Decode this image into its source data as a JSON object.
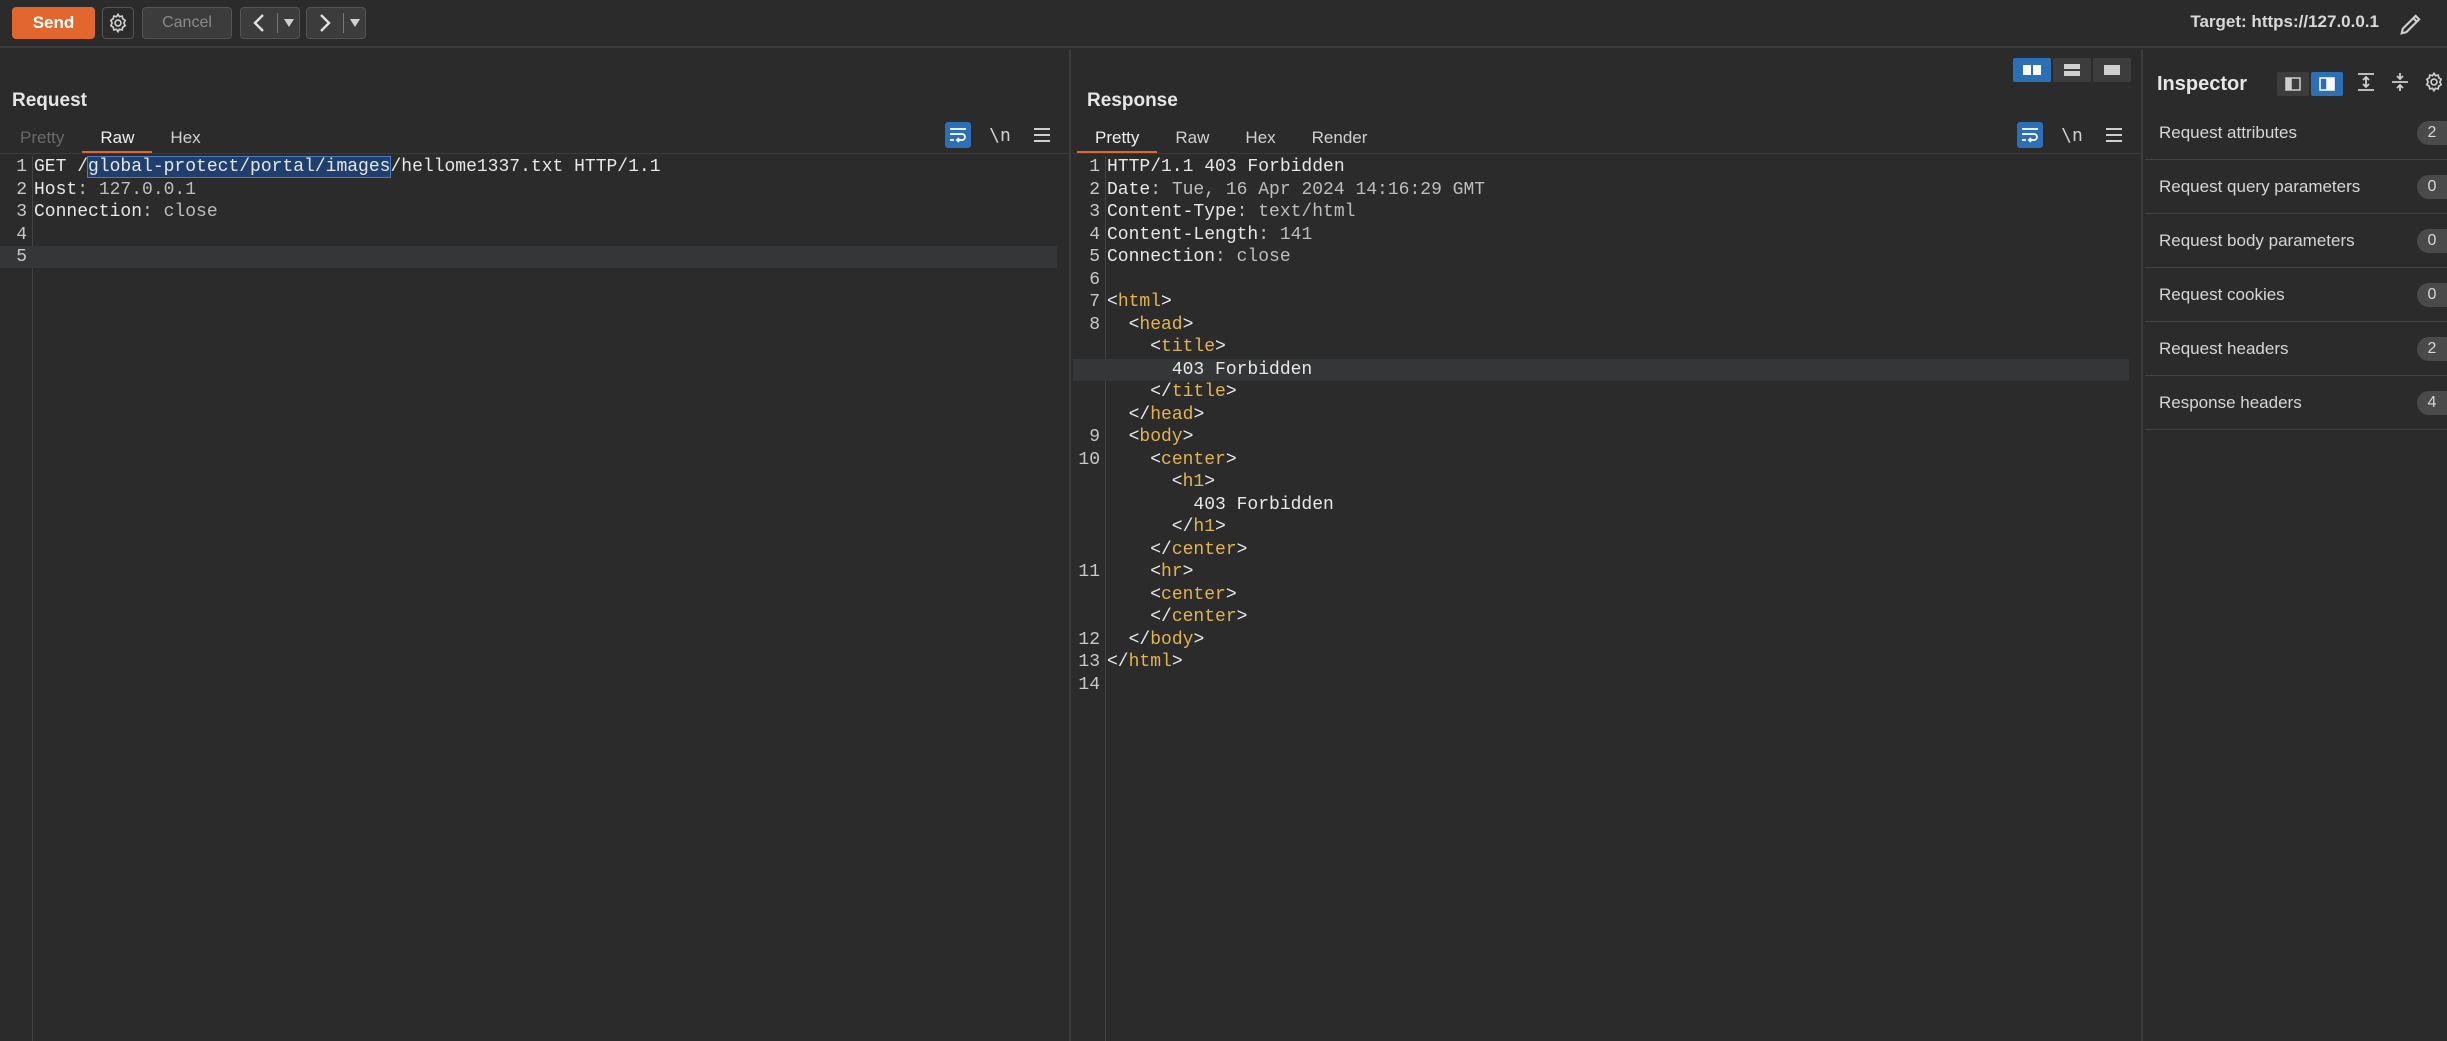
{
  "toolbar": {
    "send_label": "Send",
    "cancel_label": "Cancel",
    "target_text": "Target: https://127.0.0.1"
  },
  "request": {
    "title": "Request",
    "tabs": [
      {
        "label": "Pretty",
        "state": "disabled"
      },
      {
        "label": "Raw",
        "state": "active"
      },
      {
        "label": "Hex",
        "state": "normal"
      }
    ],
    "newline_label": "\\n",
    "lines": [
      {
        "n": "1",
        "parts": [
          {
            "t": "GET /",
            "c": "k"
          },
          {
            "t": "global-protect/portal/images",
            "c": "sel"
          },
          {
            "t": "/hellome1337.txt HTTP/1.1",
            "c": "k"
          }
        ]
      },
      {
        "n": "2",
        "parts": [
          {
            "t": "Host",
            "c": "k"
          },
          {
            "t": ": 127.0.0.1",
            "c": "v"
          }
        ]
      },
      {
        "n": "3",
        "parts": [
          {
            "t": "Connection",
            "c": "k"
          },
          {
            "t": ": close",
            "c": "v"
          }
        ]
      },
      {
        "n": "4",
        "parts": []
      },
      {
        "n": "5",
        "parts": [],
        "hl": true
      }
    ]
  },
  "response": {
    "title": "Response",
    "tabs": [
      {
        "label": "Pretty",
        "state": "active"
      },
      {
        "label": "Raw",
        "state": "normal"
      },
      {
        "label": "Hex",
        "state": "normal"
      },
      {
        "label": "Render",
        "state": "normal"
      }
    ],
    "newline_label": "\\n",
    "lines": [
      {
        "n": "1",
        "parts": [
          {
            "t": "HTTP/1.1 403 Forbidden",
            "c": "k"
          }
        ]
      },
      {
        "n": "2",
        "parts": [
          {
            "t": "Date",
            "c": "k"
          },
          {
            "t": ": Tue, 16 Apr 2024 14:16:29 GMT",
            "c": "v"
          }
        ]
      },
      {
        "n": "3",
        "parts": [
          {
            "t": "Content-Type",
            "c": "k"
          },
          {
            "t": ": text/html",
            "c": "v"
          }
        ]
      },
      {
        "n": "4",
        "parts": [
          {
            "t": "Content-Length",
            "c": "k"
          },
          {
            "t": ": 141",
            "c": "v"
          }
        ]
      },
      {
        "n": "5",
        "parts": [
          {
            "t": "Connection",
            "c": "k"
          },
          {
            "t": ": close",
            "c": "v"
          }
        ]
      },
      {
        "n": "6",
        "parts": []
      },
      {
        "n": "7",
        "parts": [
          {
            "t": "<",
            "c": "k"
          },
          {
            "t": "html",
            "c": "tg"
          },
          {
            "t": ">",
            "c": "k"
          }
        ]
      },
      {
        "n": "8",
        "parts": [
          {
            "t": "  <",
            "c": "k"
          },
          {
            "t": "head",
            "c": "tg"
          },
          {
            "t": ">",
            "c": "k"
          }
        ]
      },
      {
        "n": "",
        "parts": [
          {
            "t": "    <",
            "c": "k"
          },
          {
            "t": "title",
            "c": "tg"
          },
          {
            "t": ">",
            "c": "k"
          }
        ]
      },
      {
        "n": "",
        "parts": [
          {
            "t": "      403 Forbidden",
            "c": "k"
          }
        ],
        "hl": true
      },
      {
        "n": "",
        "parts": [
          {
            "t": "    </",
            "c": "k"
          },
          {
            "t": "title",
            "c": "tg"
          },
          {
            "t": ">",
            "c": "k"
          }
        ]
      },
      {
        "n": "",
        "parts": [
          {
            "t": "  </",
            "c": "k"
          },
          {
            "t": "head",
            "c": "tg"
          },
          {
            "t": ">",
            "c": "k"
          }
        ]
      },
      {
        "n": "9",
        "parts": [
          {
            "t": "  <",
            "c": "k"
          },
          {
            "t": "body",
            "c": "tg"
          },
          {
            "t": ">",
            "c": "k"
          }
        ]
      },
      {
        "n": "10",
        "parts": [
          {
            "t": "    <",
            "c": "k"
          },
          {
            "t": "center",
            "c": "tg"
          },
          {
            "t": ">",
            "c": "k"
          }
        ]
      },
      {
        "n": "",
        "parts": [
          {
            "t": "      <",
            "c": "k"
          },
          {
            "t": "h1",
            "c": "tg"
          },
          {
            "t": ">",
            "c": "k"
          }
        ]
      },
      {
        "n": "",
        "parts": [
          {
            "t": "        403 Forbidden",
            "c": "k"
          }
        ]
      },
      {
        "n": "",
        "parts": [
          {
            "t": "      </",
            "c": "k"
          },
          {
            "t": "h1",
            "c": "tg"
          },
          {
            "t": ">",
            "c": "k"
          }
        ]
      },
      {
        "n": "",
        "parts": [
          {
            "t": "    </",
            "c": "k"
          },
          {
            "t": "center",
            "c": "tg"
          },
          {
            "t": ">",
            "c": "k"
          }
        ]
      },
      {
        "n": "11",
        "parts": [
          {
            "t": "    <",
            "c": "k"
          },
          {
            "t": "hr",
            "c": "tg"
          },
          {
            "t": ">",
            "c": "k"
          }
        ]
      },
      {
        "n": "",
        "parts": [
          {
            "t": "    <",
            "c": "k"
          },
          {
            "t": "center",
            "c": "tg"
          },
          {
            "t": ">",
            "c": "k"
          }
        ]
      },
      {
        "n": "",
        "parts": [
          {
            "t": "    </",
            "c": "k"
          },
          {
            "t": "center",
            "c": "tg"
          },
          {
            "t": ">",
            "c": "k"
          }
        ]
      },
      {
        "n": "12",
        "parts": [
          {
            "t": "  </",
            "c": "k"
          },
          {
            "t": "body",
            "c": "tg"
          },
          {
            "t": ">",
            "c": "k"
          }
        ]
      },
      {
        "n": "13",
        "parts": [
          {
            "t": "</",
            "c": "k"
          },
          {
            "t": "html",
            "c": "tg"
          },
          {
            "t": ">",
            "c": "k"
          }
        ]
      },
      {
        "n": "14",
        "parts": []
      }
    ]
  },
  "inspector": {
    "title": "Inspector",
    "rows": [
      {
        "label": "Request attributes",
        "count": "2"
      },
      {
        "label": "Request query parameters",
        "count": "0"
      },
      {
        "label": "Request body parameters",
        "count": "0"
      },
      {
        "label": "Request cookies",
        "count": "0"
      },
      {
        "label": "Request headers",
        "count": "2"
      },
      {
        "label": "Response headers",
        "count": "4"
      }
    ]
  },
  "colors": {
    "accent": "#e2672f",
    "selection_blue": "#2d6fb5",
    "tag_color": "#e3b34d",
    "background": "#2b2b2b"
  }
}
